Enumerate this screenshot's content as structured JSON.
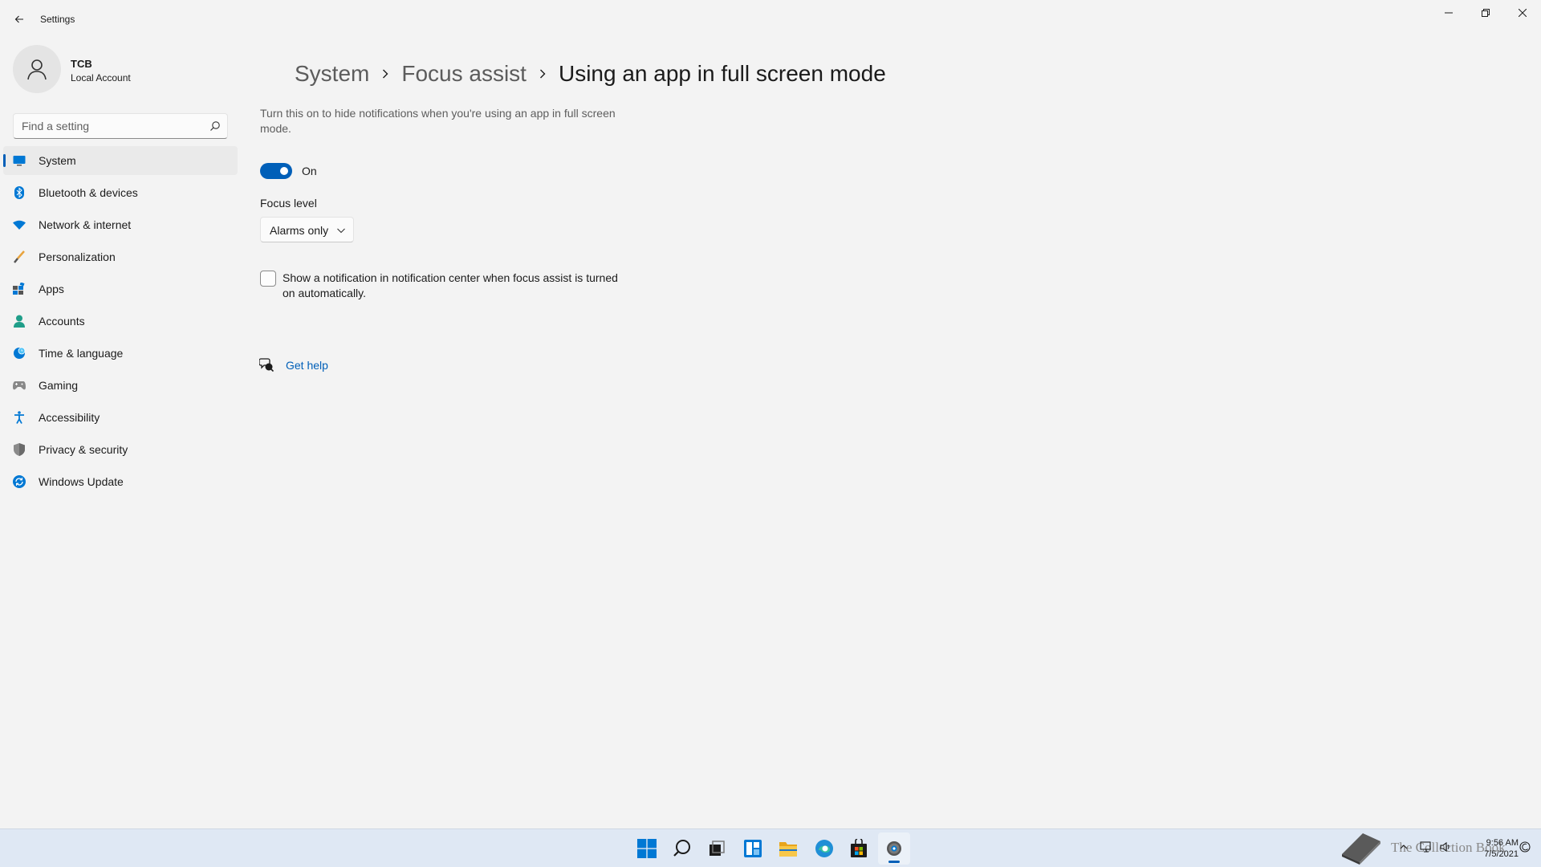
{
  "window": {
    "title": "Settings"
  },
  "user": {
    "name": "TCB",
    "account_type": "Local Account"
  },
  "search": {
    "placeholder": "Find a setting"
  },
  "sidebar": {
    "items": [
      {
        "label": "System",
        "icon": "system-icon",
        "selected": true
      },
      {
        "label": "Bluetooth & devices",
        "icon": "bluetooth-icon"
      },
      {
        "label": "Network & internet",
        "icon": "wifi-icon"
      },
      {
        "label": "Personalization",
        "icon": "brush-icon"
      },
      {
        "label": "Apps",
        "icon": "apps-icon"
      },
      {
        "label": "Accounts",
        "icon": "person-icon"
      },
      {
        "label": "Time & language",
        "icon": "globe-clock-icon"
      },
      {
        "label": "Gaming",
        "icon": "gamepad-icon"
      },
      {
        "label": "Accessibility",
        "icon": "accessibility-icon"
      },
      {
        "label": "Privacy & security",
        "icon": "shield-icon"
      },
      {
        "label": "Windows Update",
        "icon": "update-icon"
      }
    ]
  },
  "breadcrumb": {
    "items": [
      "System",
      "Focus assist"
    ],
    "current": "Using an app in full screen mode"
  },
  "main": {
    "description": "Turn this on to hide notifications when you're using an app in full screen mode.",
    "toggle": {
      "on": true,
      "state_label": "On"
    },
    "focus_level": {
      "label": "Focus level",
      "selected": "Alarms only"
    },
    "notify_checkbox": {
      "checked": false,
      "label": "Show a notification in notification center when focus assist is turned on automatically."
    },
    "help": {
      "label": "Get help",
      "icon": "help-chat-icon"
    }
  },
  "taskbar": {
    "apps": [
      {
        "name": "start",
        "icon": "windows-logo-icon"
      },
      {
        "name": "search",
        "icon": "search-icon"
      },
      {
        "name": "task-view",
        "icon": "task-view-icon"
      },
      {
        "name": "widgets",
        "icon": "widgets-icon"
      },
      {
        "name": "file-explorer",
        "icon": "folder-icon"
      },
      {
        "name": "edge",
        "icon": "edge-icon"
      },
      {
        "name": "store",
        "icon": "store-icon"
      },
      {
        "name": "settings",
        "icon": "gear-icon",
        "active": true
      }
    ],
    "watermark_text": "The Collection Book",
    "clock": {
      "time": "9:56 AM",
      "date": "7/5/2021"
    }
  },
  "colors": {
    "accent": "#005fb8",
    "background": "#f3f3f3",
    "taskbar": "#dfe8f4"
  }
}
